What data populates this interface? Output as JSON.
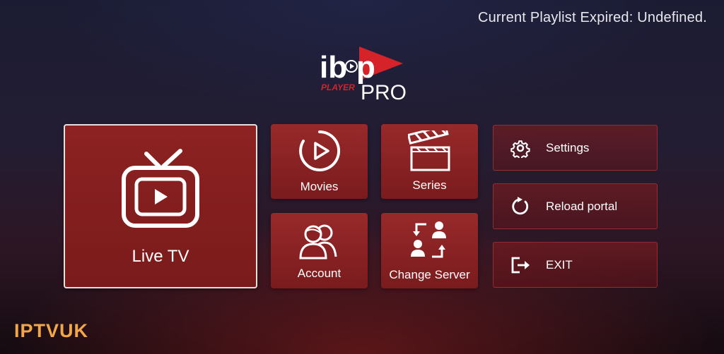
{
  "status": {
    "text": "Current Playlist Expired: Undefined."
  },
  "logo": {
    "ib": "ib",
    "p": "p",
    "player": "PLAYER",
    "pro": "PRO"
  },
  "tiles": {
    "live_tv": {
      "label": "Live TV",
      "icon": "tv-icon"
    },
    "movies": {
      "label": "Movies",
      "icon": "play-circle-icon"
    },
    "series": {
      "label": "Series",
      "icon": "clapperboard-icon"
    },
    "account": {
      "label": "Account",
      "icon": "users-icon"
    },
    "change_server": {
      "label": "Change Server",
      "icon": "swap-users-icon"
    }
  },
  "side_menu": {
    "settings": {
      "label": "Settings",
      "icon": "gear-icon"
    },
    "reload": {
      "label": "Reload portal",
      "icon": "reload-icon"
    },
    "exit": {
      "label": "EXIT",
      "icon": "exit-icon"
    }
  },
  "watermark": {
    "text": "IPTVUK"
  },
  "colors": {
    "tile": "#8a2022",
    "accent": "#e0262c",
    "watermark": "#f2a64a"
  }
}
